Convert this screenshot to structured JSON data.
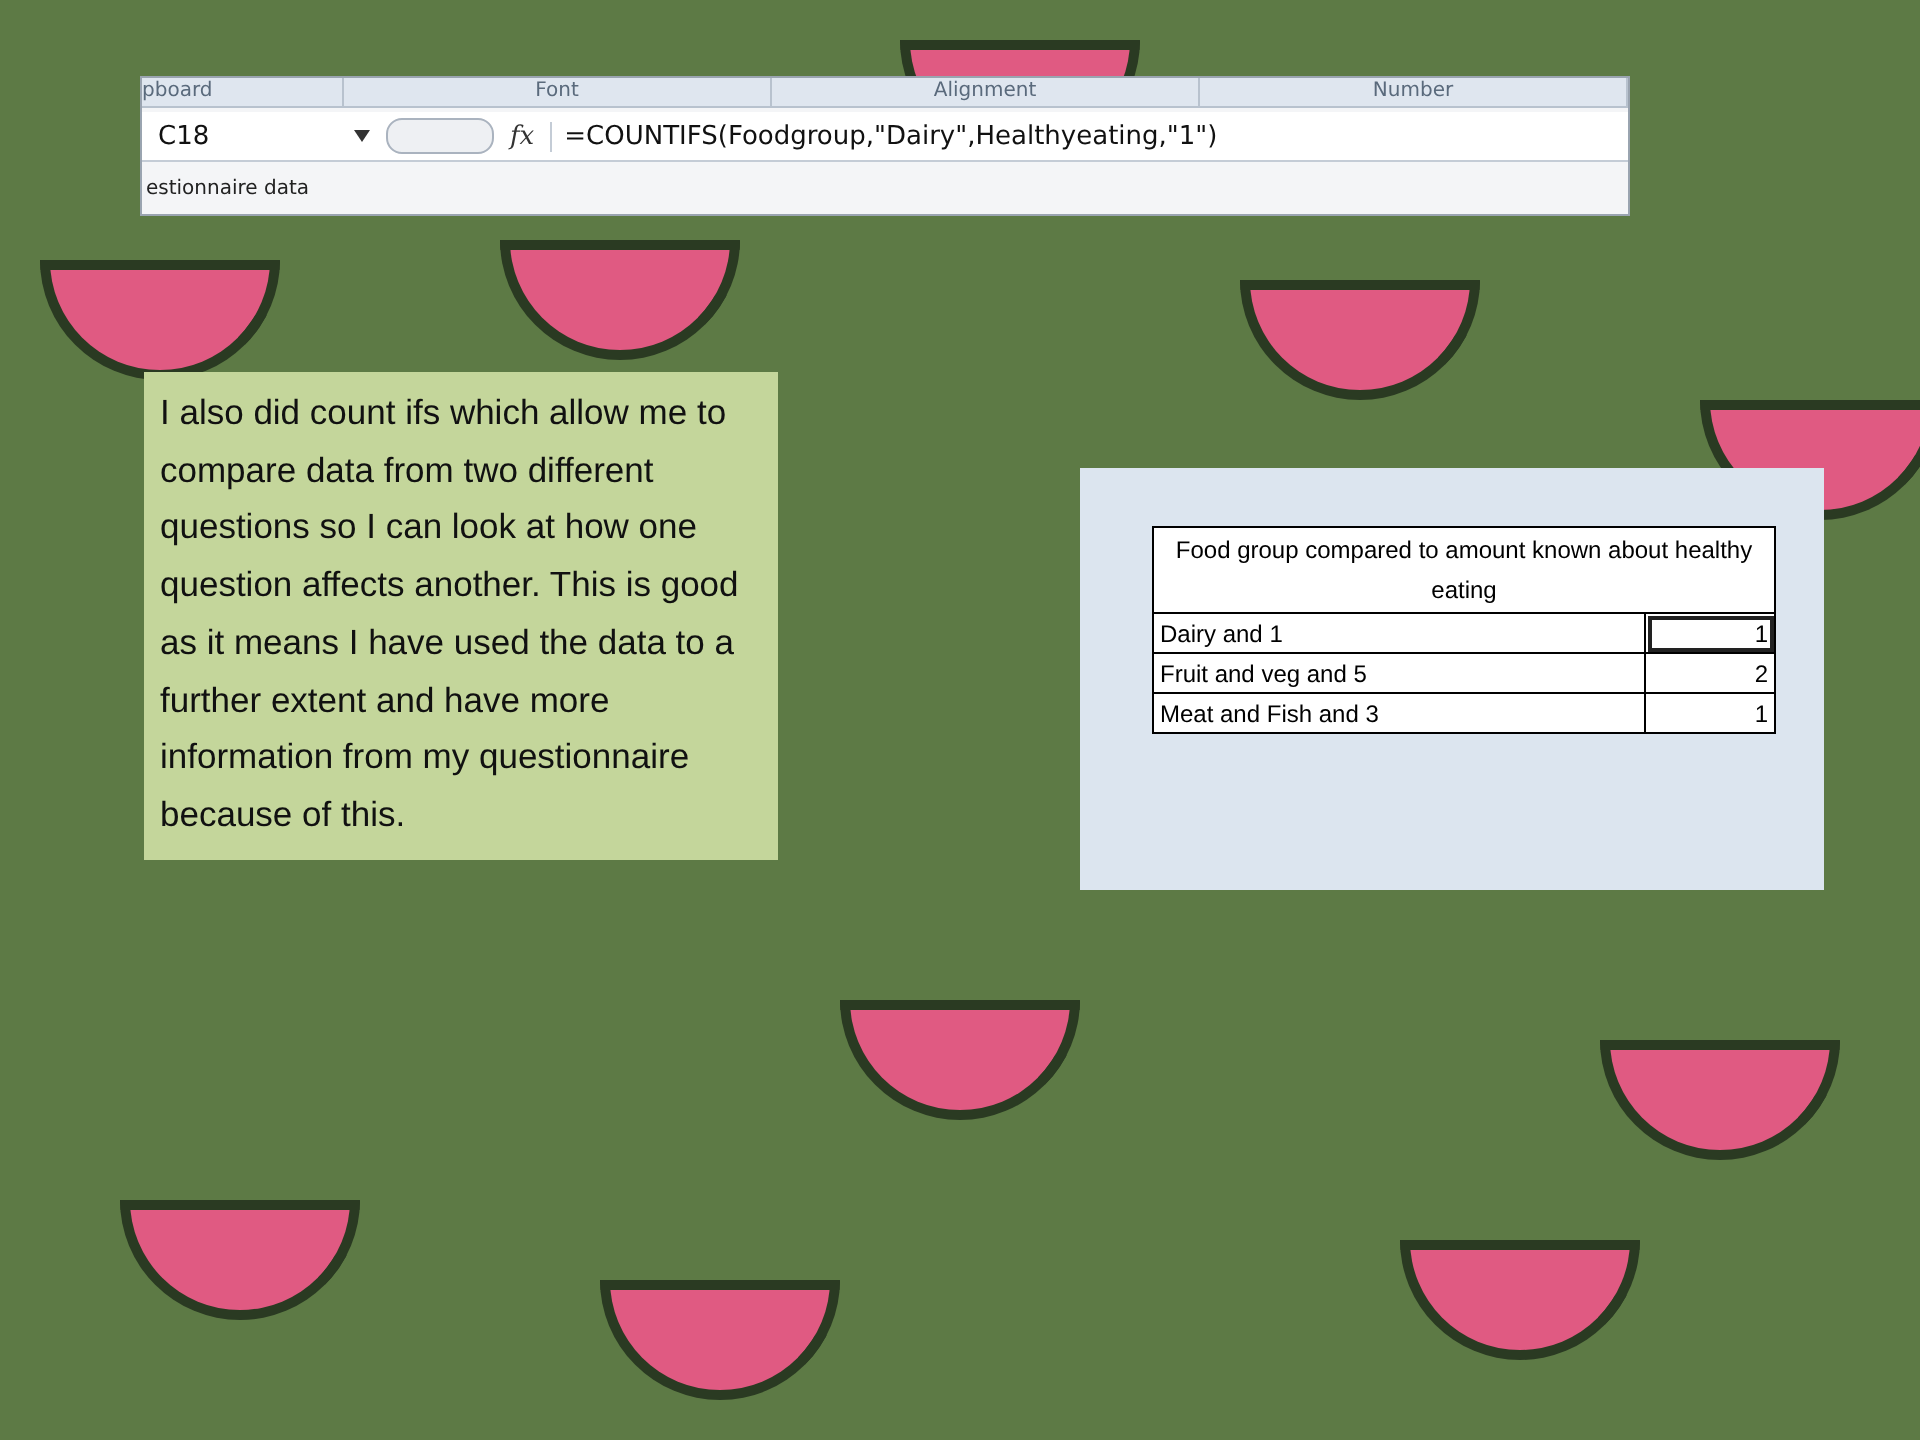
{
  "ribbon": {
    "groups": [
      "pboard",
      "Font",
      "Alignment",
      "Number"
    ]
  },
  "formula_bar": {
    "cell_ref": "C18",
    "function_label": "fx",
    "formula": "=COUNTIFS(Foodgroup,\"Dairy\",Healthyeating,\"1\")"
  },
  "sheet_tab": "estionnaire data",
  "text_box": "I also did count ifs which allow me to compare data from two different questions so I can look at how one question affects another. This is good as it means I have used the data to a further extent and have more information from my questionnaire because of this.",
  "table": {
    "title": "Food group compared to amount known about healthy eating",
    "rows": [
      {
        "label": "Dairy and 1",
        "value": "1",
        "selected": true
      },
      {
        "label": "Fruit and veg and 5",
        "value": "2",
        "selected": false
      },
      {
        "label": "Meat and Fish and 3",
        "value": "1",
        "selected": false
      }
    ]
  }
}
